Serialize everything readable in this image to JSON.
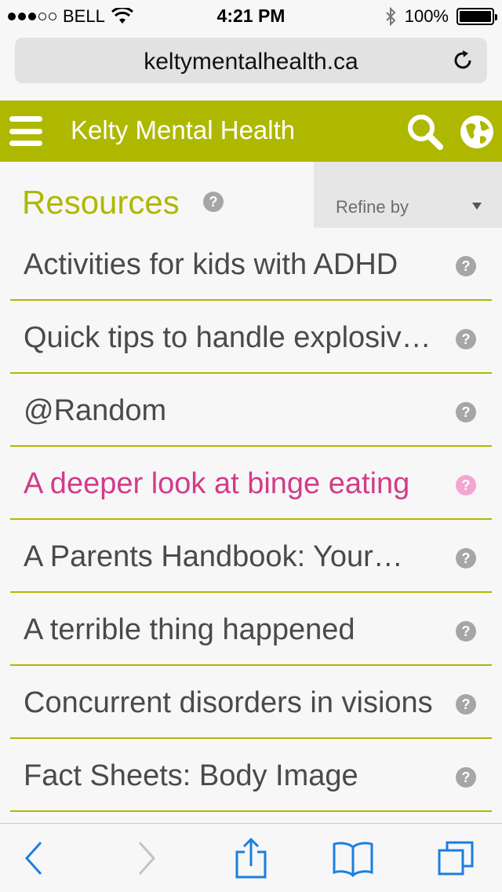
{
  "status_bar": {
    "carrier": "BELL",
    "time": "4:21 PM",
    "battery": "100%"
  },
  "browser": {
    "url": "keltymentalhealth.ca"
  },
  "header": {
    "title": "Kelty Mental Health"
  },
  "resources": {
    "title": "Resources",
    "refine_label": "Refine by"
  },
  "items": [
    {
      "label": "Activities for kids with ADHD",
      "highlight": false
    },
    {
      "label": "Quick tips to handle explosive…",
      "highlight": false
    },
    {
      "label": "@Random",
      "highlight": false
    },
    {
      "label": "A deeper look at binge eating",
      "highlight": true
    },
    {
      "label": "A Parents Handbook: Your…",
      "highlight": false
    },
    {
      "label": "A terrible thing happened",
      "highlight": false
    },
    {
      "label": "Concurrent disorders in visions",
      "highlight": false
    },
    {
      "label": "Fact Sheets: Body Image",
      "highlight": false
    }
  ],
  "icons": {
    "help": "?"
  },
  "colors": {
    "brand": "#afb800",
    "highlight": "#d23c8a",
    "toolbar_accent": "#1a7fe0"
  }
}
